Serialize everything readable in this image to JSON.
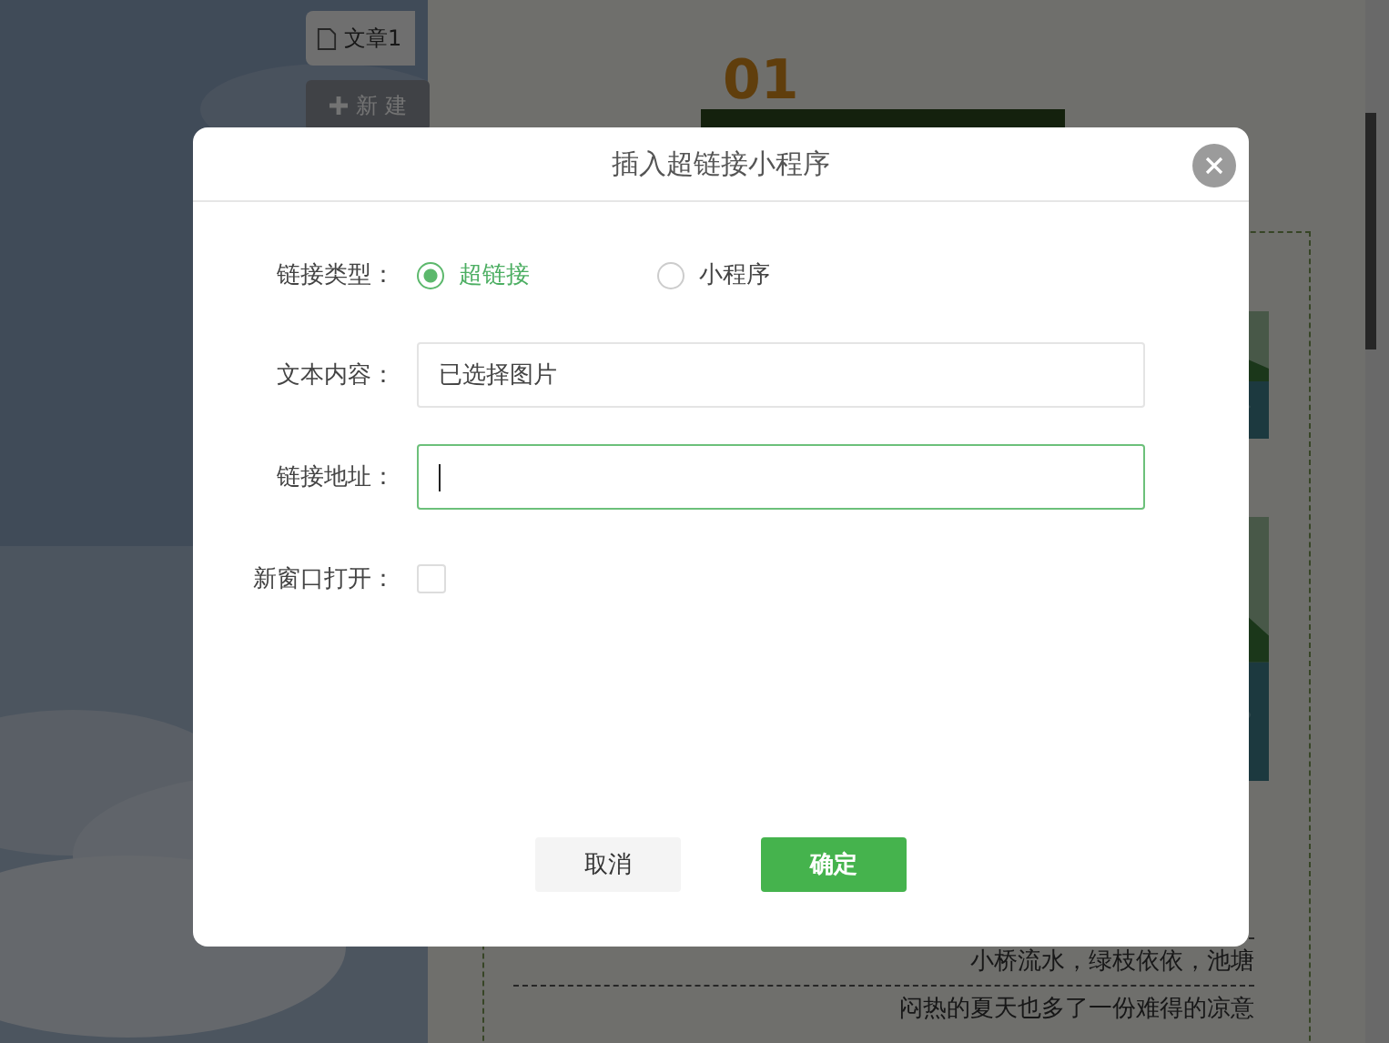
{
  "sidebar": {
    "tabs": [
      {
        "label": "文章1",
        "selected": true
      }
    ],
    "new_button": "新 建"
  },
  "article": {
    "number": "01",
    "lines": [
      "小桥流水，绿枝依依，池塘",
      "闷热的夏天也多了一份难得的凉意"
    ]
  },
  "dialog": {
    "title": "插入超链接小程序",
    "fields": [
      {
        "kind": "radio",
        "label": "链接类型：",
        "options": [
          {
            "label": "超链接",
            "selected": true
          },
          {
            "label": "小程序",
            "selected": false
          }
        ]
      },
      {
        "kind": "text",
        "label": "文本内容：",
        "value": "已选择图片",
        "focused": false
      },
      {
        "kind": "text",
        "label": "链接地址：",
        "focused": true
      },
      {
        "kind": "checkbox",
        "label": "新窗口打开：",
        "checked": false
      }
    ],
    "buttons": [
      {
        "label": "取消",
        "kind": "secondary"
      },
      {
        "label": "确定",
        "kind": "primary"
      }
    ]
  }
}
